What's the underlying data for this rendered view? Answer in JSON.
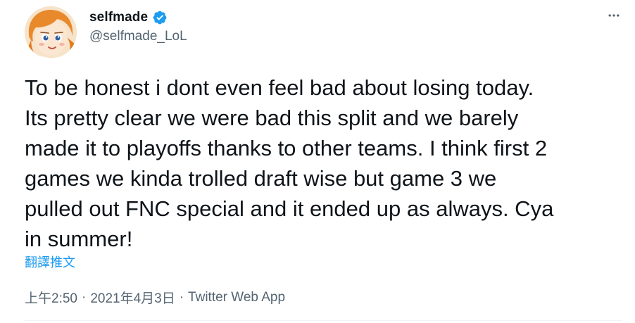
{
  "author": {
    "display_name": "selfmade",
    "handle": "@selfmade_LoL",
    "verified": true,
    "verified_color": "#1d9bf0"
  },
  "tweet": {
    "text": "To be honest i dont even feel bad about losing today.\nIts pretty clear we were bad this split and we barely\nmade it to playoffs thanks to other teams. I think first 2\ngames we kinda trolled draft wise but game 3 we\npulled out FNC special and it ended up as always. Cya\nin summer!",
    "translate_label": "翻譯推文"
  },
  "meta": {
    "time": "上午2:50",
    "separator": "·",
    "date": "2021年4月3日",
    "source": "Twitter Web App"
  },
  "icons": {
    "more": "more-dots-icon",
    "verified": "verified-badge-icon",
    "avatar": "avatar-image"
  },
  "colors": {
    "text_primary": "#0f1419",
    "text_secondary": "#536471",
    "link": "#1d9bf0"
  }
}
